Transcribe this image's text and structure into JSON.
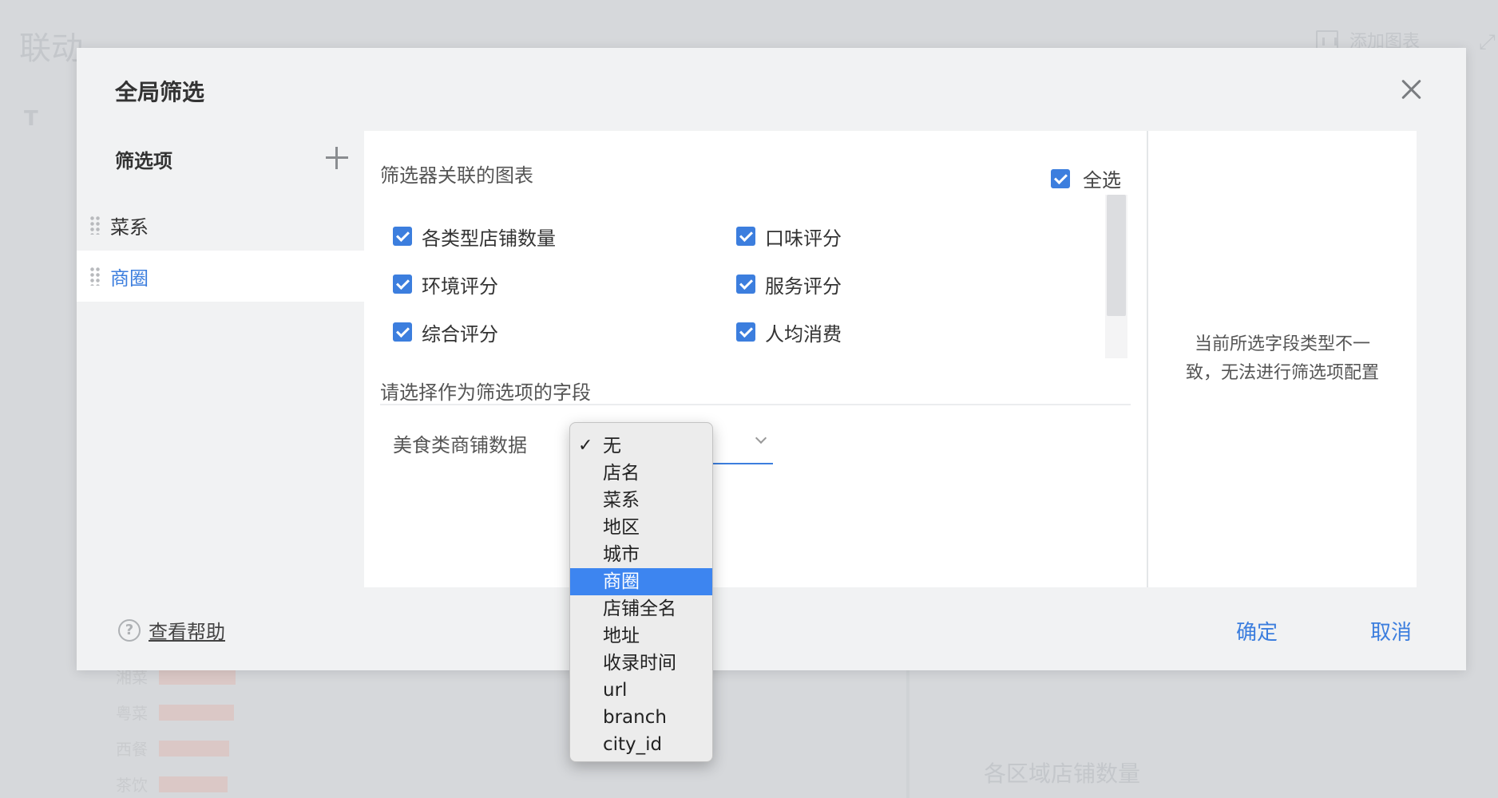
{
  "background": {
    "page_title": "联动",
    "add_chart_label": "添加图表",
    "t_label": "T",
    "chart_title": "各区域店铺数量",
    "bar_labels": [
      "湘菜",
      "粤菜",
      "西餐",
      "茶饮"
    ]
  },
  "modal": {
    "title": "全局筛选",
    "filters_header": "筛选项",
    "filter_items": [
      {
        "label": "菜系",
        "selected": false
      },
      {
        "label": "商圈",
        "selected": true
      }
    ],
    "linked_charts": {
      "title": "筛选器关联的图表",
      "select_all_label": "全选",
      "items": [
        "各类型店铺数量",
        "口味评分",
        "环境评分",
        "服务评分",
        "综合评分",
        "人均消费"
      ]
    },
    "field_section": {
      "title": "请选择作为筛选项的字段",
      "source_label": "美食类商铺数据"
    },
    "dropdown": {
      "checked": "无",
      "highlighted": "商圈",
      "options": [
        "无",
        "店名",
        "菜系",
        "地区",
        "城市",
        "商圈",
        "店铺全名",
        "地址",
        "收录时间",
        "url",
        "branch",
        "city_id"
      ]
    },
    "side_message": "当前所选字段类型不一致，无法进行筛选项配置",
    "help_label": "查看帮助",
    "confirm_label": "确定",
    "cancel_label": "取消"
  },
  "colors": {
    "accent": "#3c7ede",
    "menu_highlight": "#3d85f0"
  }
}
